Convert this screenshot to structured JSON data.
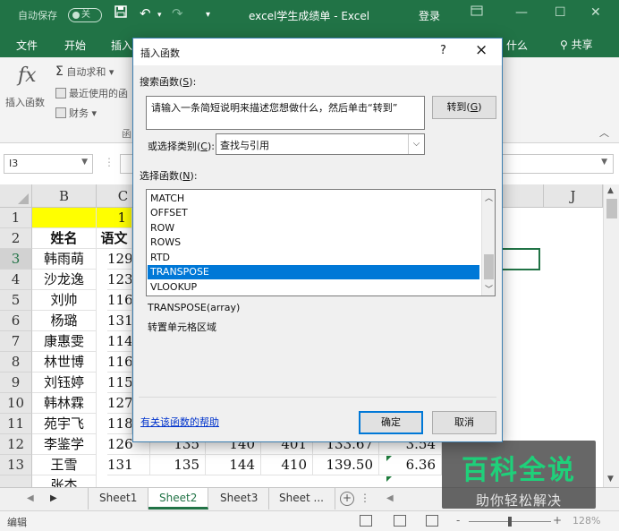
{
  "titlebar": {
    "autosave_label": "自动保存",
    "autosave_state": "关",
    "doc_title": "excel学生成绩单  -  Excel",
    "login": "登录",
    "quick_access": [
      "save-icon",
      "undo-icon",
      "redo-icon",
      "customize-icon"
    ],
    "window_controls": [
      "ribbon-display-icon",
      "minimize-icon",
      "maximize-icon",
      "close-icon"
    ]
  },
  "ribbon_tabs": {
    "tabs": [
      "文件",
      "开始",
      "插入"
    ],
    "tell_me_tail": "什么",
    "share": "共享"
  },
  "ribbon": {
    "insert_function": "插入函数",
    "fx_symbol": "fx",
    "autosum": "自动求和",
    "recent": "最近使用的函",
    "finance": "财务",
    "group_label": "函"
  },
  "formula_bar": {
    "name_box": "I3",
    "separator": "⋮"
  },
  "grid": {
    "columns": [
      "B",
      "C",
      "J"
    ],
    "row_numbers": [
      "1",
      "2",
      "3",
      "4",
      "5",
      "6",
      "7",
      "8",
      "9",
      "10",
      "11",
      "12",
      "13"
    ],
    "row1_c": "1",
    "header_b": "姓名",
    "header_c": "语文",
    "names": [
      "韩雨萌",
      "沙龙逸",
      "刘帅",
      "杨璐",
      "康惠雯",
      "林世博",
      "刘钰婷",
      "韩林霖",
      "苑宇飞",
      "李鉴学",
      "王雪"
    ],
    "c_values": [
      "129",
      "123",
      "116",
      "131",
      "114",
      "116",
      "115",
      "127",
      "118",
      "126",
      "131"
    ],
    "row12": [
      "135",
      "140",
      "401",
      "133.67",
      "3.54"
    ],
    "row13": [
      "135",
      "144",
      "410",
      "139.50",
      "6.36"
    ],
    "row14_name": "张杰"
  },
  "sheet_tabs": {
    "tabs": [
      "Sheet1",
      "Sheet2",
      "Sheet3",
      "Sheet ..."
    ],
    "active_index": 1,
    "add": "+",
    "more": "⋮"
  },
  "statusbar": {
    "mode": "编辑",
    "zoom_minus": "-",
    "zoom_plus": "+",
    "zoom_percent": "128%"
  },
  "dialog": {
    "title": "插入函数",
    "help": "?",
    "close": "×",
    "search_label": "搜索函数(",
    "search_key": "S",
    "search_label_end": "):",
    "search_text": "请输入一条简短说明来描述您想做什么，然后单击“转到”",
    "goto_label": "转到(",
    "goto_key": "G",
    "goto_end": ")",
    "category_label": "或选择类别(",
    "category_key": "C",
    "category_end": "):",
    "category_value": "查找与引用",
    "select_label": "选择函数(",
    "select_key": "N",
    "select_end": "):",
    "functions": [
      "MATCH",
      "OFFSET",
      "ROW",
      "ROWS",
      "RTD",
      "TRANSPOSE",
      "VLOOKUP"
    ],
    "selected_function": "TRANSPOSE",
    "syntax": "TRANSPOSE(array)",
    "description": "转置单元格区域",
    "help_link": "有关该函数的帮助",
    "ok": "确定",
    "cancel": "取消"
  },
  "watermark": {
    "brand": "百科全说",
    "slogan": "助你轻松解决"
  }
}
